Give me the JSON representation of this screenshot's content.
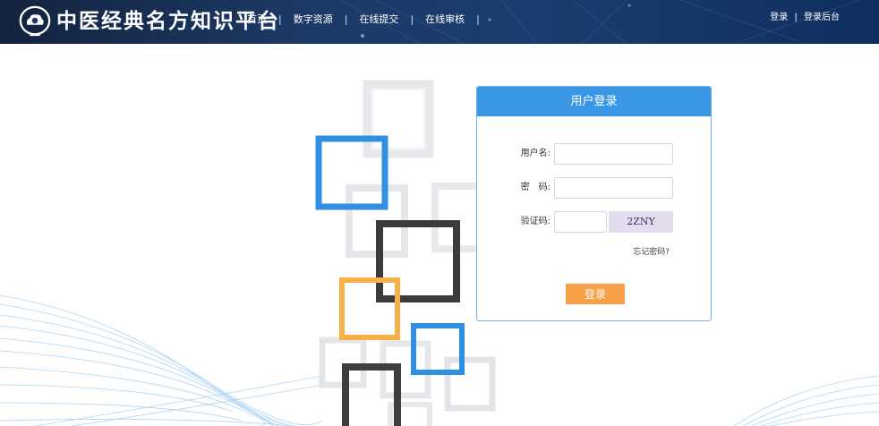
{
  "header": {
    "site_title": "中医经典名方知识平台",
    "nav": [
      "首页",
      "数字资源",
      "在线提交",
      "在线审核"
    ],
    "nav_separator": "|",
    "auth": {
      "login": "登录",
      "separator": "|",
      "admin": "登录后台"
    }
  },
  "login_box": {
    "title": "用户登录",
    "username_label": "用户名:",
    "password_label": "密　码:",
    "captcha_label": "验证码:",
    "username_value": "",
    "password_value": "",
    "captcha_value": "",
    "captcha_text": "2ZNY",
    "forgot_link": "忘记密码?",
    "submit_label": "登录"
  },
  "colors": {
    "header_bg": "#1c3a66",
    "title_bar": "#3a97e6",
    "login_button": "#f7a047",
    "captcha_bg": "#e3dcec"
  },
  "icons": {
    "logo": "cloud-logo-icon"
  }
}
